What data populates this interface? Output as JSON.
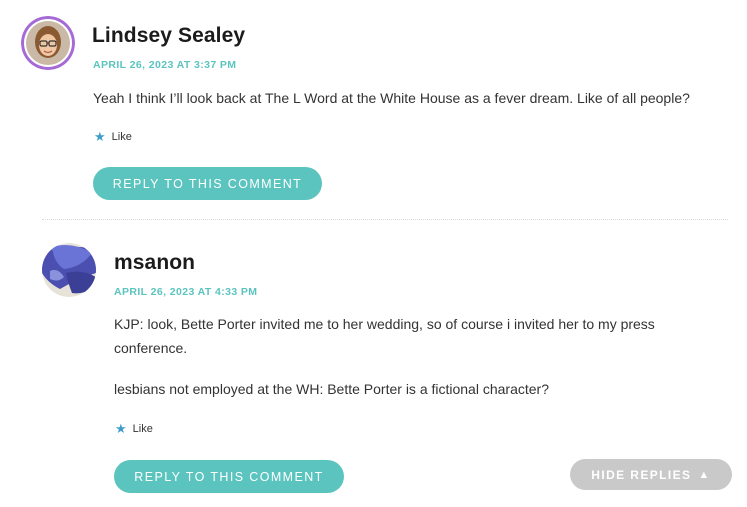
{
  "comments": [
    {
      "author": "Lindsey Sealey",
      "date": "APRIL 26, 2023 AT 3:37 PM",
      "paragraphs": [
        "Yeah I think I’ll look back at The L Word at the White House as a fever dream. Like of all people?"
      ],
      "like_label": "Like",
      "reply_label": "REPLY TO THIS COMMENT"
    },
    {
      "author": "msanon",
      "date": "APRIL 26, 2023 AT 4:33 PM",
      "paragraphs": [
        "KJP: look, Bette Porter invited me to her wedding, so of course i invited her to my press conference.",
        "lesbians not employed at the WH: Bette Porter is a fictional character?"
      ],
      "like_label": "Like",
      "reply_label": "REPLY TO THIS COMMENT"
    }
  ],
  "hide_replies": {
    "label": "HIDE REPLIES",
    "icon": "triangle-up-icon"
  },
  "colors": {
    "accent": "#5bc4bf",
    "star": "#3f9ec8",
    "hide_button": "#c9c9c9",
    "avatar_ring": "#a56ad6"
  }
}
